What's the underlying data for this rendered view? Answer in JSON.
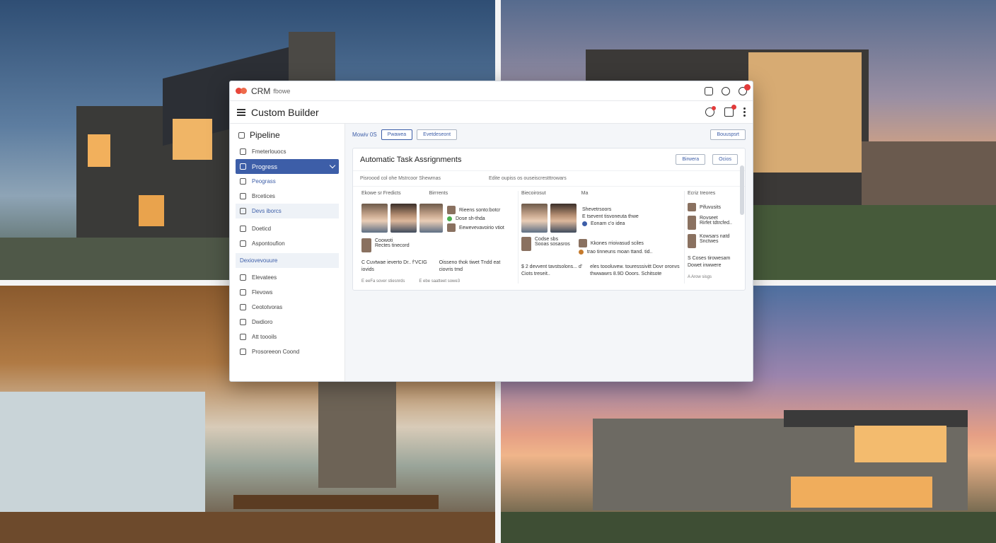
{
  "window": {
    "app_name": "CRM",
    "app_sub": "fbowe"
  },
  "header": {
    "title": "Custom Builder"
  },
  "sidebar": {
    "title": "Pipeline",
    "items": [
      {
        "label": "Fmeterlouocs"
      },
      {
        "label": "Progress"
      },
      {
        "label": "Peograss"
      },
      {
        "label": "Brcetices"
      },
      {
        "label": "Devs iborcs"
      },
      {
        "label": "Doeticd"
      },
      {
        "label": "Aspontoufion"
      },
      {
        "label": "Dexiovevouure"
      },
      {
        "label": "Elevatees"
      },
      {
        "label": "Flevows"
      },
      {
        "label": "Ceototvoras"
      },
      {
        "label": "Dwdioro"
      },
      {
        "label": "Att toooils"
      },
      {
        "label": "Prosoreeon Coond"
      }
    ]
  },
  "toolbar": {
    "label": "Mowiv 0S",
    "btn1": "Pwawea",
    "btn2": "Evetdeseont",
    "btn3": "Bouuspsrt"
  },
  "card": {
    "title": "Automatic Task Assrignments",
    "btn1": "Birwera",
    "btn2": "Ocios",
    "meta1": "Pisroood col ohe Mstrcoor Shewmas",
    "meta2": "Edite oupiss os ouseiscrestttrowars",
    "col1_head": "Ekowe sr Fredicts",
    "col2_head": "Birrrents",
    "col3_head": "Biecoirosut",
    "col4_head": "Ma",
    "col5_head": "Ecriz treores",
    "col2_lines": [
      "Rieens sonto:botcr",
      "Dose sh-thda",
      "Eewevevavoirio vtiot"
    ],
    "col1_person": "Coowoti",
    "col1_person_sub": "Rectes tinecord",
    "col1_note": "C Cuvtwae ieverto Dr.. f’VCIG iovids",
    "col2_note": "Oisseno thok tiwet Tndd eat ciovris tmd",
    "col1_foot": "E eeFa sover stiesnrds",
    "col2_foot": "E ebe saatteet sowe3",
    "col3_lines": [
      "Shevetrsoors",
      "E tsevent tisvoneuta thwe",
      "Eonarn c'o idea"
    ],
    "col3_person": "Codse sbs",
    "col3_person_sub": "Sooas sosasros",
    "col3_row2": "Kkones rrioivasud sciles",
    "col3_row3": "trao tinneuns moan ttand. tid..",
    "col3_note": "$ 2 devvent tavstsolons... d' Ciots treseit..",
    "col4_note": "eles toooluvew. touresssivitt Dovr oronvs thwwawrs 8.9D Ooors. Schitsote",
    "col5_items": [
      "Pifuvusits",
      "Rovseet",
      "Rirfet tdtrcfed..",
      "Kowsars natd",
      "Snctwes"
    ],
    "col5_note": "S Coses tirowesam Dowet inwwere",
    "col5_foot": "A Arow sisgs"
  },
  "colors": {
    "accent": "#3d5ea8",
    "badge": "#e23b3b",
    "dot_green": "#4caf50",
    "dot_blue": "#3d5ea8"
  }
}
